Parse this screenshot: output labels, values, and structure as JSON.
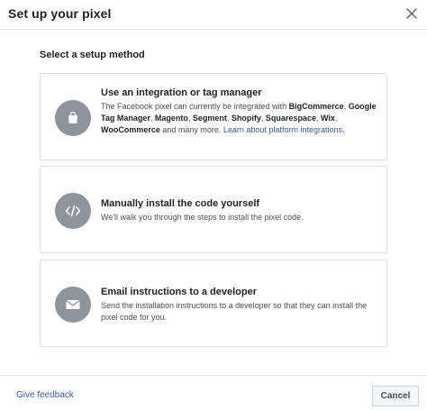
{
  "dialog": {
    "title": "Set up your pixel",
    "close_icon": "close-icon"
  },
  "main": {
    "section_label": "Select a setup method",
    "options": [
      {
        "title": "Use an integration or tag manager",
        "icon": "shopping-bag-icon",
        "desc_parts": {
          "p1": "The Facebook pixel can currently be integrated with ",
          "bigcommerce": "BigCommerce",
          "comma1": ",",
          "gtm": "Google Tag Manager",
          "comma2": ", ",
          "magento": "Magento",
          "comma3": ", ",
          "segment": "Segment",
          "comma4": ", ",
          "shopify": "Shopify",
          "comma5": ", ",
          "squarespace": "Squarespace",
          "comma6": ",",
          "wix": "Wix",
          "comma7": ", ",
          "woocommerce": "WooCommerce",
          "p2": " and many more. ",
          "link": "Learn about platform integrations",
          "p3": "."
        }
      },
      {
        "title": "Manually install the code yourself",
        "icon": "code-icon",
        "desc": "We'll walk you through the steps to install the pixel code."
      },
      {
        "title": "Email instructions to a developer",
        "icon": "envelope-icon",
        "desc": "Send the installation instructions to a developer so that they can install the pixel code for you."
      }
    ]
  },
  "footer": {
    "feedback_label": "Give feedback",
    "cancel_label": "Cancel"
  },
  "colors": {
    "link": "#385898",
    "icon_circle": "#8d949e",
    "border": "#dddfe2"
  }
}
